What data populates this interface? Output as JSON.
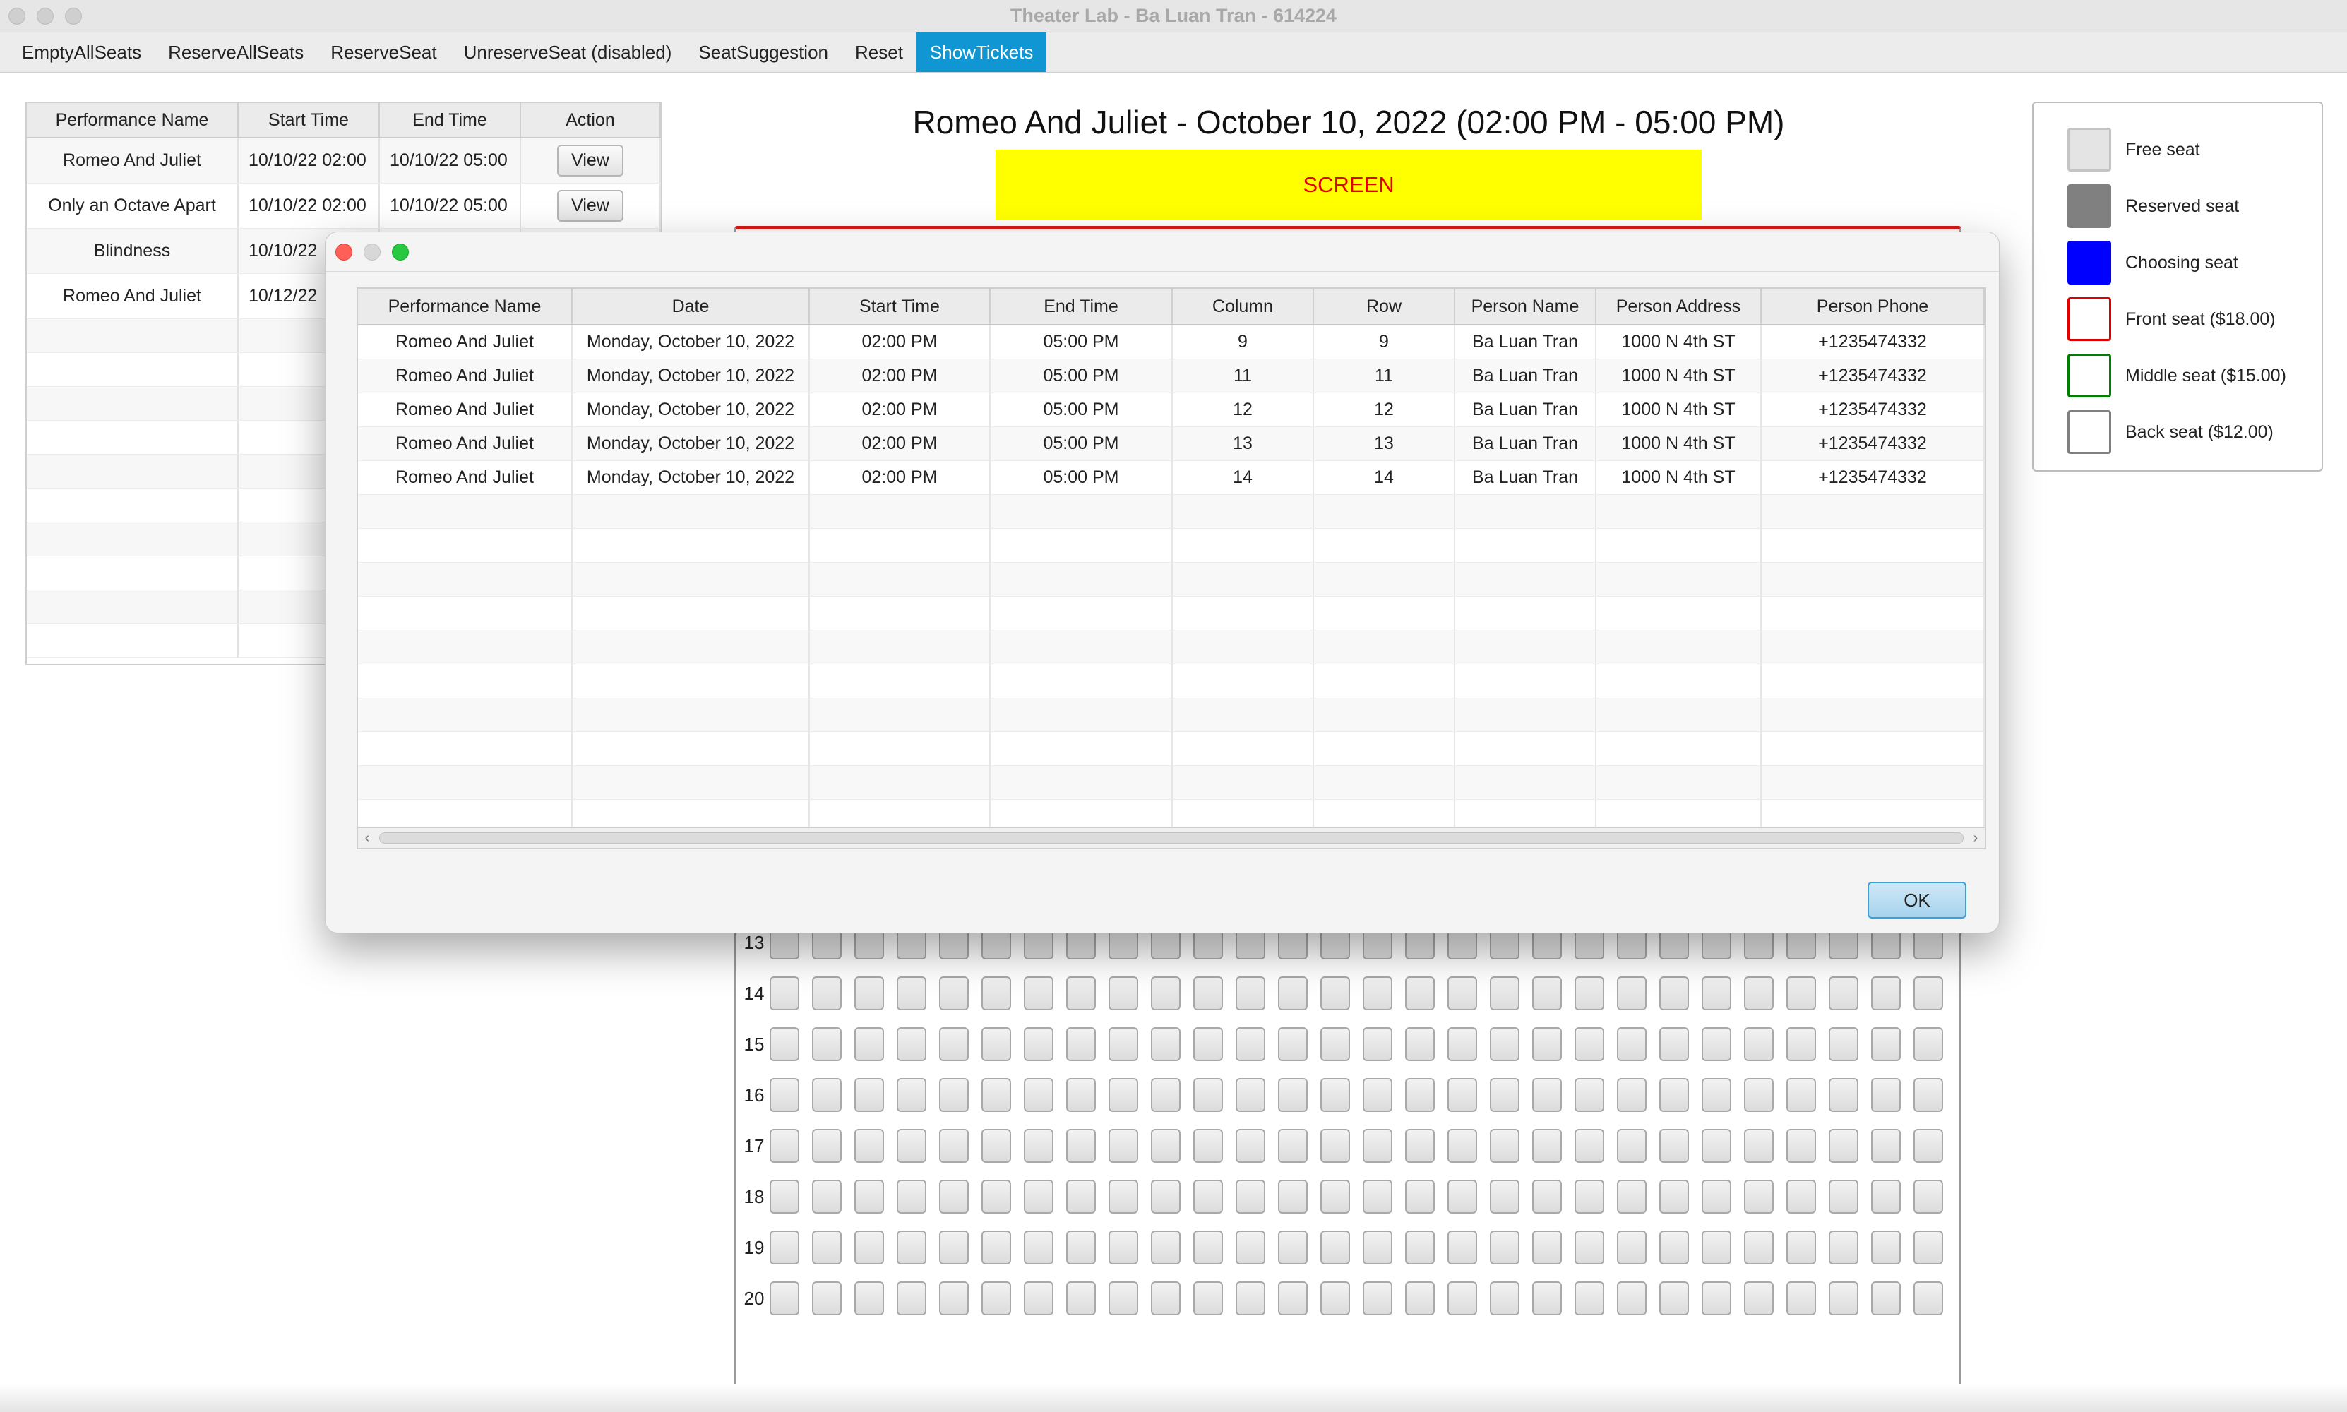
{
  "window": {
    "title": "Theater Lab - Ba Luan Tran - 614224"
  },
  "toolbar": {
    "items": [
      {
        "label": "EmptyAllSeats",
        "active": false
      },
      {
        "label": "ReserveAllSeats",
        "active": false
      },
      {
        "label": "ReserveSeat",
        "active": false
      },
      {
        "label": "UnreserveSeat (disabled)",
        "active": false
      },
      {
        "label": "SeatSuggestion",
        "active": false
      },
      {
        "label": "Reset",
        "active": false
      },
      {
        "label": "ShowTickets",
        "active": true
      }
    ],
    "active_color": "#0f96d3"
  },
  "performances": {
    "columns": [
      "Performance Name",
      "Start Time",
      "End Time",
      "Action"
    ],
    "rows": [
      {
        "name": "Romeo And Juliet",
        "start": "10/10/22 02:00",
        "end": "10/10/22 05:00",
        "action": "View"
      },
      {
        "name": "Only an Octave Apart",
        "start": "10/10/22 02:00",
        "end": "10/10/22 05:00",
        "action": "View"
      },
      {
        "name": "Blindness",
        "start": "10/10/22",
        "end": "",
        "action": ""
      },
      {
        "name": "Romeo And Juliet",
        "start": "10/12/22",
        "end": "",
        "action": ""
      }
    ]
  },
  "seating": {
    "title": "Romeo And Juliet - October 10, 2022 (02:00 PM - 05:00 PM)",
    "screen_label": "SCREEN",
    "screen_color": "#ffff00",
    "visible_rows": [
      "13",
      "14",
      "15",
      "16",
      "17",
      "18",
      "19",
      "20"
    ],
    "seats_per_row": 28
  },
  "legend": {
    "items": [
      {
        "label": "Free seat",
        "fill": "#e4e4e4",
        "border": "#c4c4c4"
      },
      {
        "label": "Reserved seat",
        "fill": "#808080",
        "border": "#808080"
      },
      {
        "label": "Choosing seat",
        "fill": "#0000ff",
        "border": "#0000ff"
      },
      {
        "label": "Front seat ($18.00)",
        "fill": "#ffffff",
        "border": "#e00000"
      },
      {
        "label": "Middle seat ($15.00)",
        "fill": "#ffffff",
        "border": "#008000"
      },
      {
        "label": "Back seat ($12.00)",
        "fill": "#ffffff",
        "border": "#808080"
      }
    ]
  },
  "tickets_dialog": {
    "columns": [
      "Performance Name",
      "Date",
      "Start Time",
      "End Time",
      "Column",
      "Row",
      "Person Name",
      "Person Address",
      "Person Phone"
    ],
    "rows": [
      [
        "Romeo And Juliet",
        "Monday, October 10, 2022",
        "02:00 PM",
        "05:00 PM",
        "9",
        "9",
        "Ba Luan Tran",
        "1000 N 4th ST",
        "+1235474332"
      ],
      [
        "Romeo And Juliet",
        "Monday, October 10, 2022",
        "02:00 PM",
        "05:00 PM",
        "11",
        "11",
        "Ba Luan Tran",
        "1000 N 4th ST",
        "+1235474332"
      ],
      [
        "Romeo And Juliet",
        "Monday, October 10, 2022",
        "02:00 PM",
        "05:00 PM",
        "12",
        "12",
        "Ba Luan Tran",
        "1000 N 4th ST",
        "+1235474332"
      ],
      [
        "Romeo And Juliet",
        "Monday, October 10, 2022",
        "02:00 PM",
        "05:00 PM",
        "13",
        "13",
        "Ba Luan Tran",
        "1000 N 4th ST",
        "+1235474332"
      ],
      [
        "Romeo And Juliet",
        "Monday, October 10, 2022",
        "02:00 PM",
        "05:00 PM",
        "14",
        "14",
        "Ba Luan Tran",
        "1000 N 4th ST",
        "+1235474332"
      ]
    ],
    "ok_label": "OK"
  }
}
